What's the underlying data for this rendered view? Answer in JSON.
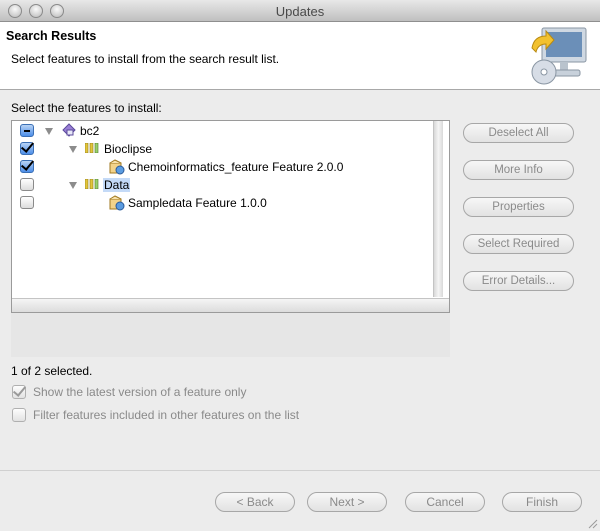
{
  "window": {
    "title": "Updates"
  },
  "header": {
    "title": "Search Results",
    "description": "Select features to install from the search result list."
  },
  "tree": {
    "label": "Select the features to install:",
    "items": [
      {
        "label": "bc2",
        "state": "mixed",
        "icon": "site-icon",
        "level": 0
      },
      {
        "label": "Bioclipse",
        "state": "checked",
        "icon": "category-icon",
        "level": 1
      },
      {
        "label": "Chemoinformatics_feature Feature 2.0.0",
        "state": "checked",
        "icon": "feature-icon",
        "level": 2
      },
      {
        "label": "Data",
        "state": "unchecked",
        "icon": "category-icon",
        "level": 1,
        "selected": true
      },
      {
        "label": "Sampledata Feature 1.0.0",
        "state": "unchecked",
        "icon": "feature-icon",
        "level": 2
      }
    ]
  },
  "side_buttons": {
    "deselect_all": "Deselect All",
    "more_info": "More Info",
    "properties": "Properties",
    "select_required": "Select Required",
    "error_details": "Error Details..."
  },
  "status": "1 of 2 selected.",
  "options": {
    "latest_version": {
      "label": "Show the latest version of a feature only",
      "checked": true
    },
    "filter_included": {
      "label": "Filter features included in other features on the list",
      "checked": false
    }
  },
  "nav": {
    "back": "< Back",
    "next": "Next >",
    "cancel": "Cancel",
    "finish": "Finish"
  },
  "colors": {
    "selection": "#c4daf7",
    "checkbox_checked": "#4d8ee8"
  }
}
